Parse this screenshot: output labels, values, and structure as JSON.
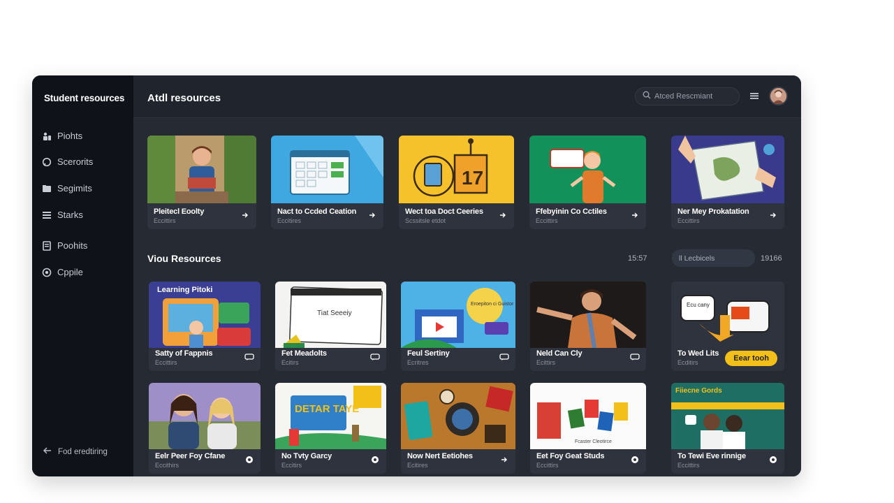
{
  "sidebar": {
    "title": "Student resources",
    "items": [
      {
        "label": "Piohts",
        "icon": "people-icon"
      },
      {
        "label": "Scerorits",
        "icon": "chat-icon"
      },
      {
        "label": "Segimits",
        "icon": "folder-icon"
      },
      {
        "label": "Starks",
        "icon": "list-icon"
      },
      {
        "label": "Poohits",
        "icon": "document-icon"
      },
      {
        "label": "Cppile",
        "icon": "globe-icon"
      }
    ],
    "footer_link": "Fod eredtiring"
  },
  "header": {
    "title": "Atdl resources",
    "search_placeholder": "Atced Rescmiant"
  },
  "featured": {
    "cards": [
      {
        "title": "Pleitecl Eoolty",
        "subtitle": "Eccittirs"
      },
      {
        "title": "Nact to Ccded Ceation",
        "subtitle": "Eccitires"
      },
      {
        "title": "Wect toa Doct Ceeries",
        "subtitle": "Scssitsle etdot"
      },
      {
        "title": "Ffebyinin Co Cctiles",
        "subtitle": "Eccittirs"
      },
      {
        "title": "Ner Mey Prokatation",
        "subtitle": "Eccittirs"
      }
    ]
  },
  "your_resources": {
    "title": "Viou Resources",
    "meta_left": "15:57",
    "filter": "ll Lecbicels",
    "meta_right": "19166",
    "cards": [
      {
        "title": "Satty of Fappnis",
        "subtitle": "Eccittirs",
        "thumb_text": "Learning Pitoki"
      },
      {
        "title": "Fet Meadolts",
        "subtitle": "Ecitirs",
        "thumb_text": "Tiat Seeeiy"
      },
      {
        "title": "Feul Sertiny",
        "subtitle": "Ecritres",
        "thumb_text": "Eroepiton ci Guistor"
      },
      {
        "title": "Neld Can Cly",
        "subtitle": "Ecittirs",
        "thumb_text": ""
      },
      {
        "title": "To Wed Lits",
        "subtitle": "Ecditirs",
        "thumb_text": "Ecu cany",
        "button": "Eear tooh"
      },
      {
        "title": "Eelr Peer Foy Cfane",
        "subtitle": "Eccithirs",
        "thumb_text": ""
      },
      {
        "title": "No Tvty Garcy",
        "subtitle": "Eccitirs",
        "thumb_text": "DETAR TAYE"
      },
      {
        "title": "Now Nert Eetiohes",
        "subtitle": "Ecitires",
        "thumb_text": ""
      },
      {
        "title": "Eet Foy Geat Studs",
        "subtitle": "Eccittirs",
        "thumb_text": "Fcaster Cleotirce"
      },
      {
        "title": "To Tewi Eve rinnige",
        "subtitle": "Eccittirs",
        "thumb_text": "Fiiecne Gords"
      }
    ]
  },
  "colors": {
    "accent_yellow": "#f3c01a",
    "sidebar_bg": "#0f1218",
    "main_bg": "#262a33"
  }
}
